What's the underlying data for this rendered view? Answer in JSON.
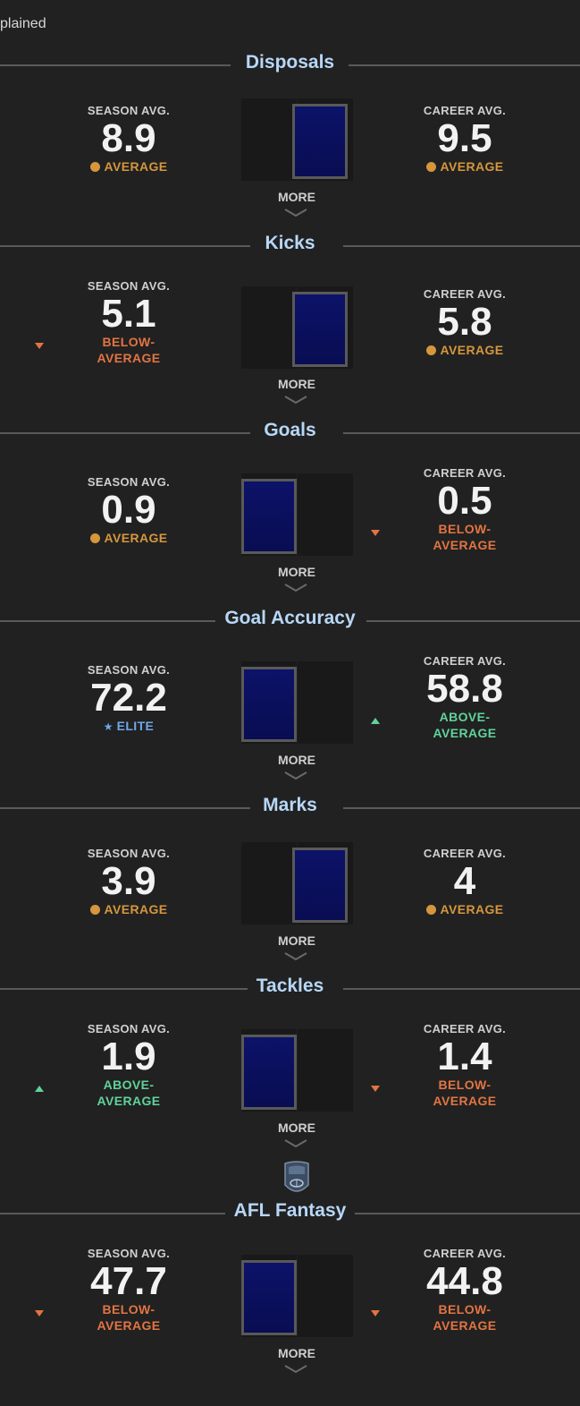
{
  "top_text": "plained",
  "season_label": "SEASON AVG.",
  "career_label": "CAREER AVG.",
  "more_label": "MORE",
  "logo_icon": "afl-fantasy-shield-icon",
  "colors": {
    "background": "#212121",
    "title": "#b7d7f7",
    "average": "#d5963c",
    "below": "#e27442",
    "above": "#5fd39a",
    "elite": "#6fa8ea",
    "meter": "#0c1268"
  },
  "sections": [
    {
      "title": "Disposals",
      "season": {
        "value": "8.9",
        "rating": "AVERAGE",
        "type": "avg"
      },
      "career": {
        "value": "9.5",
        "rating": "AVERAGE",
        "type": "avg"
      },
      "meter_side": "right"
    },
    {
      "title": "Kicks",
      "season": {
        "value": "5.1",
        "rating": "BELOW-\nAVERAGE",
        "type": "below"
      },
      "career": {
        "value": "5.8",
        "rating": "AVERAGE",
        "type": "avg"
      },
      "meter_side": "right"
    },
    {
      "title": "Goals",
      "season": {
        "value": "0.9",
        "rating": "AVERAGE",
        "type": "avg"
      },
      "career": {
        "value": "0.5",
        "rating": "BELOW-\nAVERAGE",
        "type": "below"
      },
      "meter_side": "left"
    },
    {
      "title": "Goal Accuracy",
      "season": {
        "value": "72.2",
        "rating": "ELITE",
        "type": "elite"
      },
      "career": {
        "value": "58.8",
        "rating": "ABOVE-\nAVERAGE",
        "type": "above"
      },
      "meter_side": "left"
    },
    {
      "title": "Marks",
      "season": {
        "value": "3.9",
        "rating": "AVERAGE",
        "type": "avg"
      },
      "career": {
        "value": "4",
        "rating": "AVERAGE",
        "type": "avg"
      },
      "meter_side": "right"
    },
    {
      "title": "Tackles",
      "season": {
        "value": "1.9",
        "rating": "ABOVE-\nAVERAGE",
        "type": "above"
      },
      "career": {
        "value": "1.4",
        "rating": "BELOW-\nAVERAGE",
        "type": "below"
      },
      "meter_side": "left"
    },
    {
      "title": "AFL Fantasy",
      "season": {
        "value": "47.7",
        "rating": "BELOW-\nAVERAGE",
        "type": "below"
      },
      "career": {
        "value": "44.8",
        "rating": "BELOW-\nAVERAGE",
        "type": "below"
      },
      "meter_side": "left"
    }
  ]
}
